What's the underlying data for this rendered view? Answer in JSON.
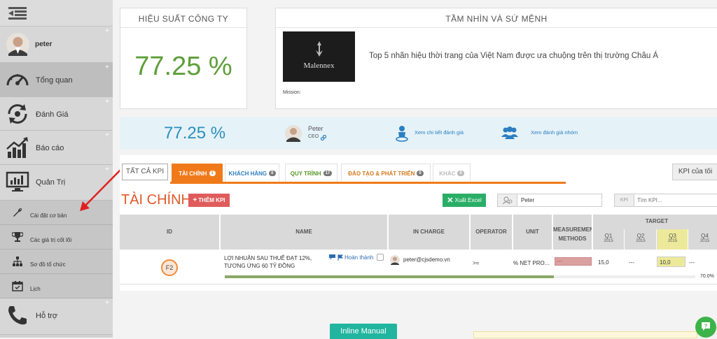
{
  "user": {
    "name": "peter"
  },
  "nav": {
    "items": [
      {
        "label": "Tổng quan",
        "icon": "speedometer-icon"
      },
      {
        "label": "Đánh Giá",
        "icon": "refresh-gauge-icon"
      },
      {
        "label": "Báo cáo",
        "icon": "bar-chart-icon"
      },
      {
        "label": "Quản Trị",
        "icon": "monitor-chart-icon"
      }
    ],
    "sub_items": [
      {
        "label": "Cài đặt cơ bản",
        "icon": "wrench-icon"
      },
      {
        "label": "Các giá trị cốt lõi",
        "icon": "trophy-icon"
      },
      {
        "label": "Sơ đồ tổ chức",
        "icon": "org-chart-icon"
      },
      {
        "label": "Lịch",
        "icon": "calendar-icon"
      }
    ],
    "support": {
      "label": "Hỗ trợ",
      "icon": "phone-icon"
    }
  },
  "performance": {
    "title": "HIỆU SUẤT CÔNG TY",
    "value": "77.25 %"
  },
  "vision": {
    "title": "TẦM NHÌN VÀ SỨ MỆNH",
    "logo_text": "Malennex",
    "text": "Top 5 nhãn hiệu thời trang của Việt Nam được ưa chuộng trên thị trường Châu Á",
    "mission_label": "Mission:"
  },
  "summary": {
    "value": "77.25 %",
    "person_name": "Peter",
    "person_role": "CEO",
    "link_detail": "Xem chi tiết đánh giá",
    "link_group": "Xem đánh giá nhóm"
  },
  "tabs": {
    "all": "TẤT CẢ KPI",
    "items": [
      {
        "label": "TÀI CHÍNH",
        "count": "1",
        "color": "#ffffff"
      },
      {
        "label": "KHÁCH HÀNG",
        "count": "0",
        "color": "#2f7fc1"
      },
      {
        "label": "QUY TRÌNH",
        "count": "17",
        "color": "#5a9a2e"
      },
      {
        "label": "ĐÀO TẠO & PHÁT TRIỂN",
        "count": "0",
        "color": "#d47a1f"
      },
      {
        "label": "KHÁC",
        "count": "0",
        "color": "#bbbbbb"
      }
    ],
    "my_kpi": "KPI của tôi"
  },
  "section": {
    "title": "TÀI CHÍNH",
    "add_button": "THÊM KPI",
    "export_button": "Xuất Excel",
    "user_filter": "Peter",
    "kpi_label": "KPI",
    "search_placeholder": "Tìm KPI..."
  },
  "table": {
    "headers": {
      "id": "ID",
      "name": "NAME",
      "in_charge": "IN CHARGE",
      "operator": "OPERATOR",
      "unit": "UNIT",
      "measure": "MEASUREMENT METHODS",
      "target": "TARGET"
    },
    "quarters": [
      {
        "q": "Q1",
        "year": "2015"
      },
      {
        "q": "Q2",
        "year": "2015"
      },
      {
        "q": "Q3",
        "year": "2015"
      },
      {
        "q": "Q4",
        "year": "2015"
      }
    ],
    "row": {
      "id": "F2",
      "name": "LỢI NHUẬN SAU THUẾ ĐẠT 12%, TƯƠNG ỨNG 60 TỶ ĐỒNG",
      "status": "Hoàn thành",
      "in_charge": "peter@cjsdemo.vn",
      "operator": ">=",
      "unit": "% NET PRO...",
      "measure": "---",
      "targets": [
        "15,0",
        "---",
        "10,0",
        "---"
      ],
      "progress_text": "70.0%",
      "progress": 0.7
    }
  },
  "inline_manual": "Inline Manual"
}
